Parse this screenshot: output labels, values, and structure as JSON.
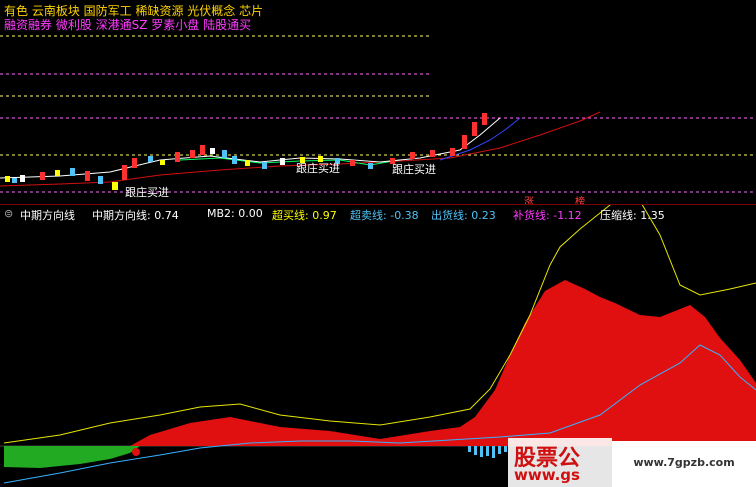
{
  "concepts": {
    "line1": "有色 云南板块 国防军工 稀缺资源 光伏概念 芯片",
    "line2": "融资融券 微利股 深港通SZ 罗素小盘 陆股通买"
  },
  "chart_signals": {
    "buy_label": "跟庄买进"
  },
  "indicator": {
    "name": "中期方向线",
    "fields": [
      {
        "label": "中期方向线:",
        "value": "0.74",
        "color": "#ffffff"
      },
      {
        "label": "MB2:",
        "value": "0.00",
        "color": "#ffffff"
      },
      {
        "label": "超买线:",
        "value": "0.97",
        "color": "#ffff00"
      },
      {
        "label": "超卖线:",
        "value": "-0.38",
        "color": "#4fc3f7"
      },
      {
        "label": "出货线:",
        "value": "0.23",
        "color": "#4fc3f7"
      },
      {
        "label": "补货线:",
        "value": "-1.12",
        "color": "#ff3cff"
      },
      {
        "label": "压缩线:",
        "value": "1.35",
        "color": "#ffffff"
      }
    ]
  },
  "tags": {
    "zhang": "涨",
    "bang": "榜"
  },
  "watermark": {
    "brand": "股票公",
    "url": "www.gs",
    "site": "www.7gpzb.com"
  }
}
